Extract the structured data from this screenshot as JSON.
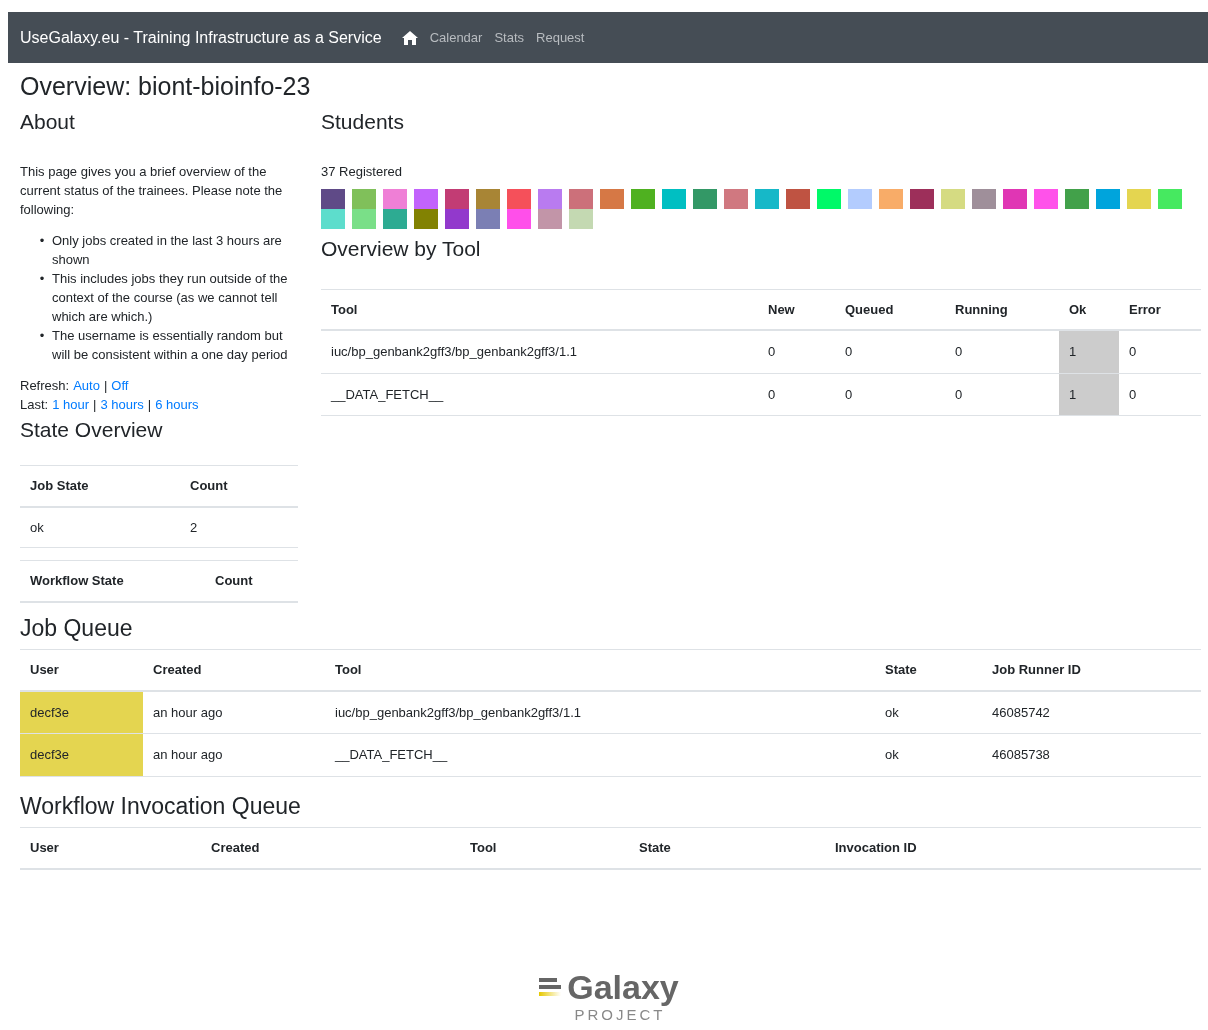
{
  "navbar": {
    "brand": "UseGalaxy.eu - Training Infrastructure as a Service",
    "links": [
      "Calendar",
      "Stats",
      "Request"
    ]
  },
  "page_title": "Overview: biont-bioinfo-23",
  "about": {
    "heading": "About",
    "intro": "This page gives you a brief overview of the current status of the trainees. Please note the following:",
    "bullet": "•",
    "separator": "|",
    "notes": [
      "Only jobs created in the last 3 hours are shown",
      "This includes jobs they run outside of the context of the course (as we cannot tell which are which.)",
      "The username is essentially random but will be consistent within a one day period"
    ],
    "refresh_label": "Refresh:",
    "refresh_links": [
      "Auto",
      "Off"
    ],
    "last_label": "Last:",
    "last_links": [
      "1 hour",
      "3 hours",
      "6 hours"
    ]
  },
  "state_overview": {
    "heading": "State Overview",
    "job_columns": [
      "Job State",
      "Count"
    ],
    "job_rows": [
      [
        "ok",
        "2"
      ]
    ],
    "workflow_columns": [
      "Workflow State",
      "Count"
    ]
  },
  "students": {
    "heading": "Students",
    "registered": "37 Registered",
    "items": [
      {
        "color": "#5f4a87"
      },
      {
        "color": "#80c05a"
      },
      {
        "color": "#ef7fd6"
      },
      {
        "color": "#c263fc"
      },
      {
        "color": "#c23c74"
      },
      {
        "color": "#a88535"
      },
      {
        "color": "#f5505a"
      },
      {
        "color": "#b97bf0"
      },
      {
        "color": "#cc707a"
      },
      {
        "color": "#d67845"
      },
      {
        "color": "#4fb120"
      },
      {
        "color": "#00bfc2"
      },
      {
        "color": "#339866"
      },
      {
        "color": "#d07880"
      },
      {
        "color": "#16b8c8"
      },
      {
        "color": "#bf5342"
      },
      {
        "color": "#00f968"
      },
      {
        "color": "#b3ccfe"
      },
      {
        "color": "#f8ac68"
      },
      {
        "color": "#9d2f5a"
      },
      {
        "color": "#d5db82"
      },
      {
        "color": "#9f8f9a"
      },
      {
        "color": "#e036b4"
      },
      {
        "color": "#ff52ea"
      },
      {
        "color": "#42a14a"
      },
      {
        "color": "#00a4dc"
      },
      {
        "color": "#e4d550"
      },
      {
        "color": "#46e960"
      },
      {
        "color": "#5dddcc"
      },
      {
        "color": "#7adf88"
      },
      {
        "color": "#2dab92"
      },
      {
        "color": "#828202"
      },
      {
        "color": "#9239cc"
      },
      {
        "color": "#7b7fb4"
      },
      {
        "color": "#ff4fea"
      },
      {
        "color": "#c295a8"
      },
      {
        "color": "#c4d9b2"
      }
    ]
  },
  "overview_by_tool": {
    "heading": "Overview by Tool",
    "columns": [
      "Tool",
      "New",
      "Queued",
      "Running",
      "Ok",
      "Error"
    ],
    "rows": [
      {
        "tool": "iuc/bp_genbank2gff3/bp_genbank2gff3/1.1",
        "new": "0",
        "queued": "0",
        "running": "0",
        "ok": "1",
        "error": "0",
        "ok_highlighted": true
      },
      {
        "tool": "__DATA_FETCH__",
        "new": "0",
        "queued": "0",
        "running": "0",
        "ok": "1",
        "error": "0",
        "ok_highlighted": true
      }
    ]
  },
  "job_queue": {
    "heading": "Job Queue",
    "columns": [
      "User",
      "Created",
      "Tool",
      "State",
      "Job Runner ID"
    ],
    "rows": [
      {
        "user": "decf3e",
        "color": "#e4d550",
        "created": "an hour ago",
        "tool": "iuc/bp_genbank2gff3/bp_genbank2gff3/1.1",
        "state": "ok",
        "job_runner_id": "46085742"
      },
      {
        "user": "decf3e",
        "color": "#e4d550",
        "created": "an hour ago",
        "tool": "__DATA_FETCH__",
        "state": "ok",
        "job_runner_id": "46085738"
      }
    ]
  },
  "workflow_queue": {
    "heading": "Workflow Invocation Queue",
    "columns": [
      "User",
      "Created",
      "Tool",
      "State",
      "Invocation ID"
    ]
  },
  "footer": {
    "logo_word": "Galaxy",
    "logo_sub": "PROJECT"
  }
}
